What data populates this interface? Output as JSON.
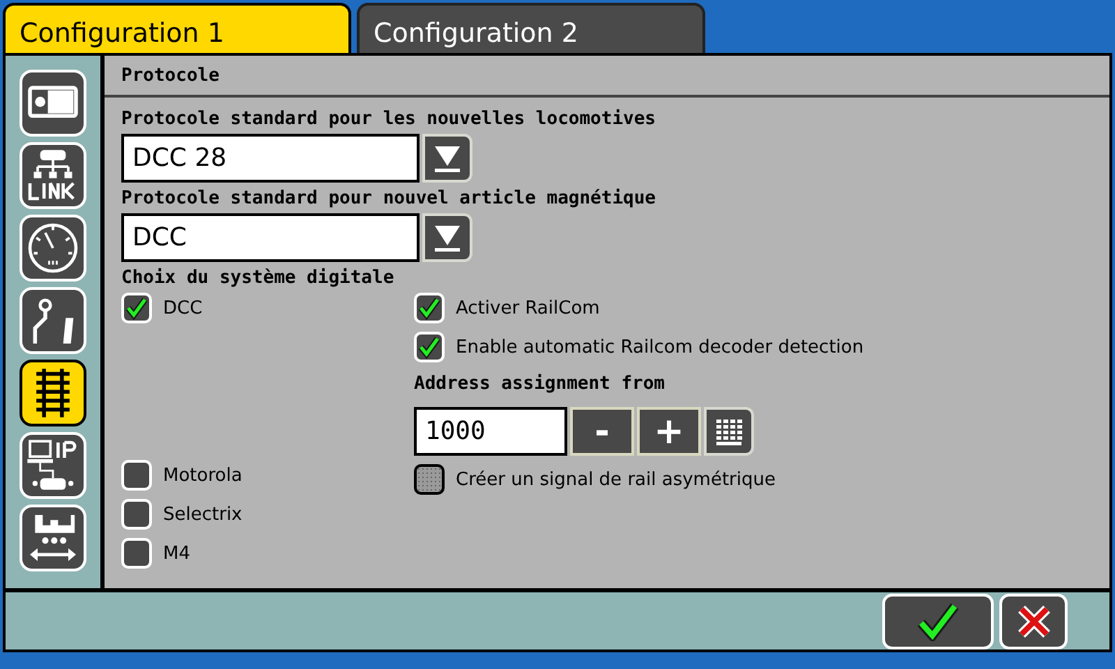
{
  "tabs": [
    {
      "label": "Configuration 1",
      "selected": true
    },
    {
      "label": "Configuration 2",
      "selected": false
    }
  ],
  "sidebar": {
    "items": [
      {
        "kind": "device",
        "selected": false
      },
      {
        "kind": "link",
        "selected": false
      },
      {
        "kind": "gauge",
        "selected": false
      },
      {
        "kind": "turnout",
        "selected": false
      },
      {
        "kind": "track",
        "selected": true
      },
      {
        "kind": "ip",
        "selected": false
      },
      {
        "kind": "loco",
        "selected": false
      }
    ]
  },
  "section_title": "Protocole",
  "dropdowns": [
    {
      "label": "Protocole standard pour les nouvelles locomotives",
      "value": "DCC 28"
    },
    {
      "label": "Protocole standard pour nouvel article magnétique",
      "value": "DCC"
    }
  ],
  "system_label": "Choix du système digitale",
  "systems": [
    {
      "label": "DCC",
      "checked": true
    },
    {
      "label": "Motorola",
      "checked": false
    },
    {
      "label": "Selectrix",
      "checked": false
    },
    {
      "label": "M4",
      "checked": false
    }
  ],
  "railcom": [
    {
      "label": "Activer RailCom",
      "checked": true
    },
    {
      "label": "Enable automatic Railcom decoder detection",
      "checked": true
    }
  ],
  "address": {
    "label": "Address assignment from",
    "value": "1000",
    "buttons": [
      "-",
      "+"
    ]
  },
  "asymmetric": {
    "label": "Créer un signal de rail asymétrique",
    "checked": false,
    "disabled": true
  }
}
